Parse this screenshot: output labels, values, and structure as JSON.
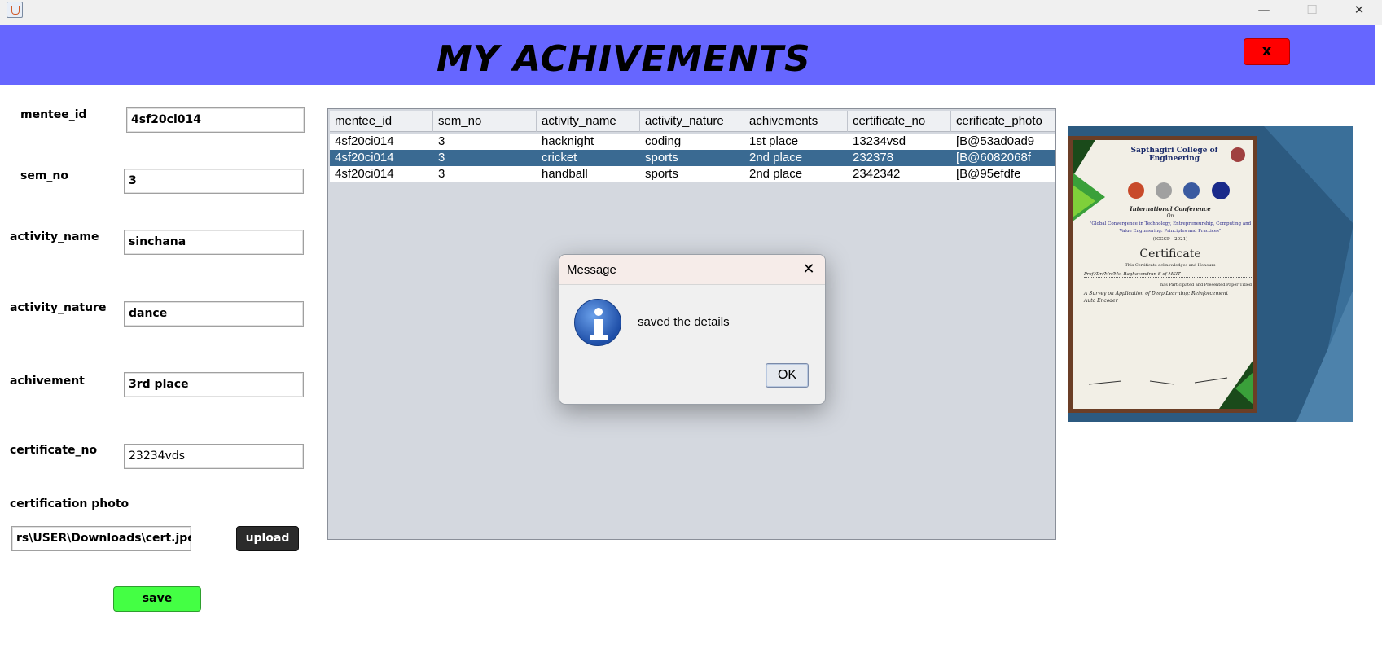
{
  "window": {
    "minimize_glyph": "—",
    "maximize_glyph": "☐",
    "close_glyph": "✕"
  },
  "header": {
    "title": "MY ACHIVEMENTS",
    "close_label": "x"
  },
  "form": {
    "mentee_id": {
      "label": "mentee_id",
      "value": "4sf20ci014"
    },
    "sem_no": {
      "label": "sem_no",
      "value": "3"
    },
    "activity_name": {
      "label": "activity_name",
      "value": "sinchana"
    },
    "activity_nature": {
      "label": "activity_nature",
      "value": "dance"
    },
    "achivement": {
      "label": "achivement",
      "value": "3rd place"
    },
    "certificate_no": {
      "label": "certificate_no",
      "value": "23234vds"
    },
    "certification_photo": {
      "label": "certification photo",
      "value": "rs\\USER\\Downloads\\cert.jpeg"
    },
    "upload_label": "upload",
    "save_label": "save"
  },
  "table": {
    "columns": [
      "mentee_id",
      "sem_no",
      "activity_name",
      "activity_nature",
      "achivements",
      "certificate_no",
      "cerificate_photo"
    ],
    "rows": [
      [
        "4sf20ci014",
        "3",
        "hacknight",
        "coding",
        "1st place",
        "13234vsd",
        "[B@53ad0ad9"
      ],
      [
        "4sf20ci014",
        "3",
        "cricket",
        "sports",
        "2nd place",
        "232378",
        "[B@6082068f"
      ],
      [
        "4sf20ci014",
        "3",
        "handball",
        "sports",
        "2nd place",
        "2342342",
        "[B@95efdfe"
      ]
    ],
    "selected_row": 1
  },
  "certificate_preview": {
    "college": "Sapthagiri College of Engineering",
    "event": "International Conference",
    "on": "On",
    "theme": "\"Global Convergence in Technology, Entrepreneurship, Computing and Value Engineering: Principles and Practices\"",
    "code": "(ICGCP—2021)",
    "heading": "Certificate",
    "line1": "This Certificate acknowledges and Honours",
    "name_line": "Prof./Dr./Mr./Ms. Raghavendran S of MSIT",
    "line2": "has Participated and Presented Paper Titled",
    "paper": "A Survey on Application of Deep Learning: Reinforcement Auto Encoder"
  },
  "dialog": {
    "title": "Message",
    "message": "saved the details",
    "ok_label": "OK",
    "icon": "info-icon"
  },
  "colors": {
    "header_bg": "#6666ff",
    "close_button": "#ff0000",
    "save_button": "#44ff44",
    "upload_button": "#2b2b2b",
    "selected_row": "#3a6a92"
  }
}
